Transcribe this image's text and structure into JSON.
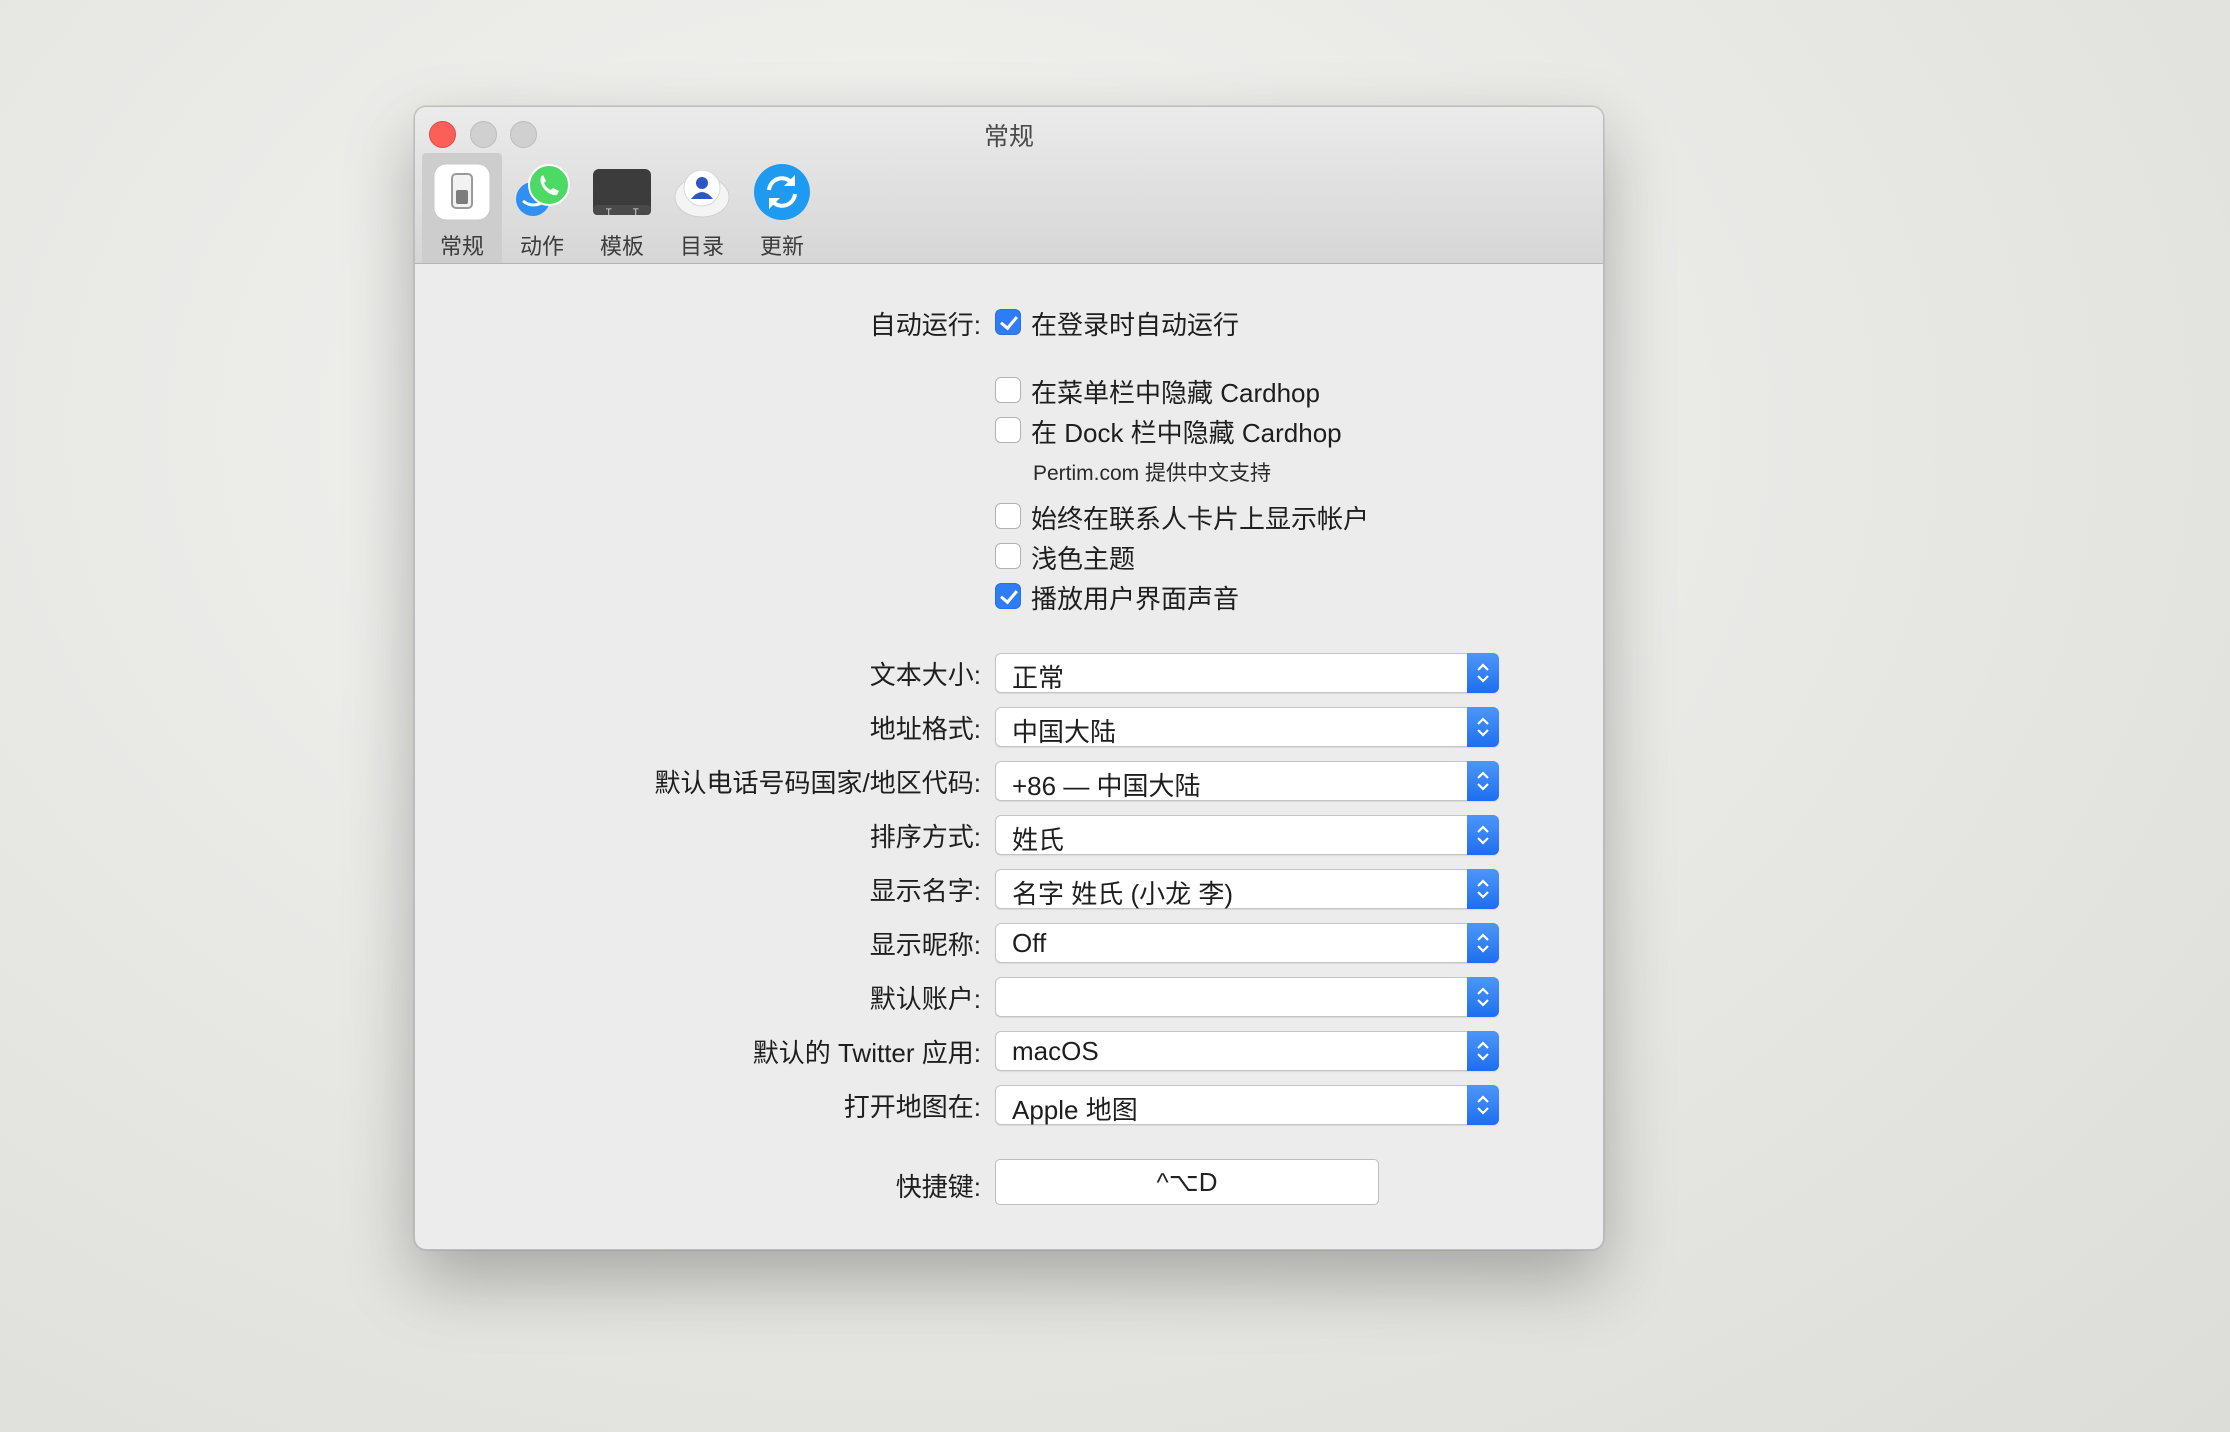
{
  "window": {
    "title": "常规"
  },
  "toolbar": {
    "items": [
      {
        "label": "常规",
        "icon": "general-switch-icon",
        "selected": true
      },
      {
        "label": "动作",
        "icon": "actions-phone-icon",
        "selected": false
      },
      {
        "label": "模板",
        "icon": "templates-card-icon",
        "selected": false
      },
      {
        "label": "目录",
        "icon": "directory-person-icon",
        "selected": false
      },
      {
        "label": "更新",
        "icon": "update-refresh-icon",
        "selected": false
      }
    ]
  },
  "general": {
    "autorun_label": "自动运行:",
    "options": [
      {
        "label": "在登录时自动运行",
        "checked": true
      },
      {
        "label": "在菜单栏中隐藏 Cardhop",
        "checked": false
      },
      {
        "label": "在 Dock 栏中隐藏 Cardhop",
        "checked": false
      },
      {
        "label": "始终在联系人卡片上显示帐户",
        "checked": false
      },
      {
        "label": "浅色主题",
        "checked": false
      },
      {
        "label": "播放用户界面声音",
        "checked": true
      }
    ],
    "note": "Pertim.com 提供中文支持",
    "selects": [
      {
        "label": "文本大小:",
        "value": "正常"
      },
      {
        "label": "地址格式:",
        "value": "中国大陆"
      },
      {
        "label": "默认电话号码国家/地区代码:",
        "value": "+86 — 中国大陆"
      },
      {
        "label": "排序方式:",
        "value": "姓氏"
      },
      {
        "label": "显示名字:",
        "value": "名字 姓氏 (小龙 李)"
      },
      {
        "label": "显示昵称:",
        "value": "Off"
      },
      {
        "label": "默认账户:",
        "value": ""
      },
      {
        "label": "默认的 Twitter 应用:",
        "value": "macOS"
      },
      {
        "label": "打开地图在:",
        "value": "Apple 地图"
      }
    ],
    "shortcut_label": "快捷键:",
    "shortcut_value": "^⌥D"
  },
  "colors": {
    "accent": "#2e7cf6",
    "close": "#fc5f57",
    "window_bg": "#ececec"
  }
}
